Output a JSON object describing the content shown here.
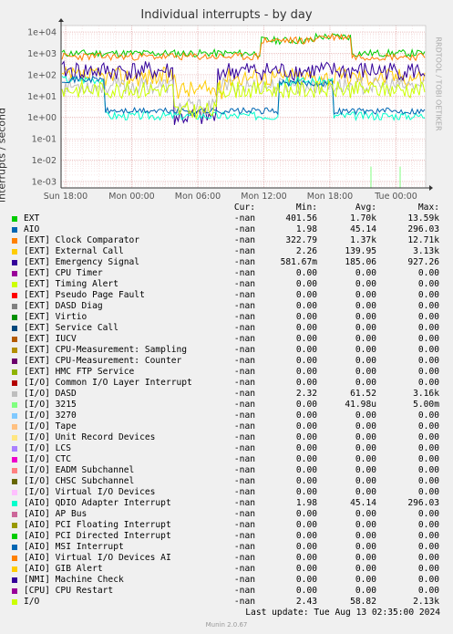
{
  "chart_data": {
    "type": "line",
    "title": "Individual interrupts - by day",
    "ylabel": "interrupts / second",
    "yscale": "log",
    "ylim": [
      0.0005,
      20000
    ],
    "y_ticks": [
      "1e-03",
      "1e-02",
      "1e-01",
      "1e+00",
      "1e+01",
      "1e+02",
      "1e+03",
      "1e+04"
    ],
    "x_ticks": [
      "Sun 18:00",
      "Mon 00:00",
      "Mon 06:00",
      "Mon 12:00",
      "Mon 18:00",
      "Tue 00:00"
    ],
    "series": [
      {
        "name": "EXT",
        "color": "#00cc00",
        "cur": "-nan",
        "min": "401.56",
        "avg": "1.70k",
        "max": "13.59k"
      },
      {
        "name": "AIO",
        "color": "#0066b3",
        "cur": "-nan",
        "min": "1.98",
        "avg": "45.14",
        "max": "296.03"
      },
      {
        "name": "[EXT] Clock Comparator",
        "color": "#ff8000",
        "cur": "-nan",
        "min": "322.79",
        "avg": "1.37k",
        "max": "12.71k"
      },
      {
        "name": "[EXT] External Call",
        "color": "#ffcc00",
        "cur": "-nan",
        "min": "2.26",
        "avg": "139.95",
        "max": "3.13k"
      },
      {
        "name": "[EXT] Emergency Signal",
        "color": "#330099",
        "cur": "-nan",
        "min": "581.67m",
        "avg": "185.06",
        "max": "927.26"
      },
      {
        "name": "[EXT] CPU Timer",
        "color": "#990099",
        "cur": "-nan",
        "min": "0.00",
        "avg": "0.00",
        "max": "0.00"
      },
      {
        "name": "[EXT] Timing Alert",
        "color": "#ccff00",
        "cur": "-nan",
        "min": "0.00",
        "avg": "0.00",
        "max": "0.00"
      },
      {
        "name": "[EXT] Pseudo Page Fault",
        "color": "#ff0000",
        "cur": "-nan",
        "min": "0.00",
        "avg": "0.00",
        "max": "0.00"
      },
      {
        "name": "[EXT] DASD Diag",
        "color": "#808080",
        "cur": "-nan",
        "min": "0.00",
        "avg": "0.00",
        "max": "0.00"
      },
      {
        "name": "[EXT] Virtio",
        "color": "#008f00",
        "cur": "-nan",
        "min": "0.00",
        "avg": "0.00",
        "max": "0.00"
      },
      {
        "name": "[EXT] Service Call",
        "color": "#00487d",
        "cur": "-nan",
        "min": "0.00",
        "avg": "0.00",
        "max": "0.00"
      },
      {
        "name": "[EXT] IUCV",
        "color": "#b35a00",
        "cur": "-nan",
        "min": "0.00",
        "avg": "0.00",
        "max": "0.00"
      },
      {
        "name": "[EXT] CPU-Measurement: Sampling",
        "color": "#b38f00",
        "cur": "-nan",
        "min": "0.00",
        "avg": "0.00",
        "max": "0.00"
      },
      {
        "name": "[EXT] CPU-Measurement: Counter",
        "color": "#6b006b",
        "cur": "-nan",
        "min": "0.00",
        "avg": "0.00",
        "max": "0.00"
      },
      {
        "name": "[EXT] HMC FTP Service",
        "color": "#8fb300",
        "cur": "-nan",
        "min": "0.00",
        "avg": "0.00",
        "max": "0.00"
      },
      {
        "name": "[I/O] Common I/O Layer Interrupt",
        "color": "#b30000",
        "cur": "-nan",
        "min": "0.00",
        "avg": "0.00",
        "max": "0.00"
      },
      {
        "name": "[I/O] DASD",
        "color": "#bebebe",
        "cur": "-nan",
        "min": "2.32",
        "avg": "61.52",
        "max": "3.16k"
      },
      {
        "name": "[I/O] 3215",
        "color": "#80ff80",
        "cur": "-nan",
        "min": "0.00",
        "avg": "41.98u",
        "max": "5.00m"
      },
      {
        "name": "[I/O] 3270",
        "color": "#80c9ff",
        "cur": "-nan",
        "min": "0.00",
        "avg": "0.00",
        "max": "0.00"
      },
      {
        "name": "[I/O] Tape",
        "color": "#ffc080",
        "cur": "-nan",
        "min": "0.00",
        "avg": "0.00",
        "max": "0.00"
      },
      {
        "name": "[I/O] Unit Record Devices",
        "color": "#ffe680",
        "cur": "-nan",
        "min": "0.00",
        "avg": "0.00",
        "max": "0.00"
      },
      {
        "name": "[I/O] LCS",
        "color": "#aa80ff",
        "cur": "-nan",
        "min": "0.00",
        "avg": "0.00",
        "max": "0.00"
      },
      {
        "name": "[I/O] CTC",
        "color": "#ee00cc",
        "cur": "-nan",
        "min": "0.00",
        "avg": "0.00",
        "max": "0.00"
      },
      {
        "name": "[I/O] EADM Subchannel",
        "color": "#ff8080",
        "cur": "-nan",
        "min": "0.00",
        "avg": "0.00",
        "max": "0.00"
      },
      {
        "name": "[I/O] CHSC Subchannel",
        "color": "#666600",
        "cur": "-nan",
        "min": "0.00",
        "avg": "0.00",
        "max": "0.00"
      },
      {
        "name": "[I/O] Virtual I/O Devices",
        "color": "#ffbfff",
        "cur": "-nan",
        "min": "0.00",
        "avg": "0.00",
        "max": "0.00"
      },
      {
        "name": "[AIO] QDIO Adapter Interrupt",
        "color": "#00ffcc",
        "cur": "-nan",
        "min": "1.98",
        "avg": "45.14",
        "max": "296.03"
      },
      {
        "name": "[AIO] AP Bus",
        "color": "#cc6699",
        "cur": "-nan",
        "min": "0.00",
        "avg": "0.00",
        "max": "0.00"
      },
      {
        "name": "[AIO] PCI Floating Interrupt",
        "color": "#999900",
        "cur": "-nan",
        "min": "0.00",
        "avg": "0.00",
        "max": "0.00"
      },
      {
        "name": "[AIO] PCI Directed Interrupt",
        "color": "#00cc00",
        "cur": "-nan",
        "min": "0.00",
        "avg": "0.00",
        "max": "0.00"
      },
      {
        "name": "[AIO] MSI Interrupt",
        "color": "#0066b3",
        "cur": "-nan",
        "min": "0.00",
        "avg": "0.00",
        "max": "0.00"
      },
      {
        "name": "[AIO] Virtual I/O Devices AI",
        "color": "#ff8000",
        "cur": "-nan",
        "min": "0.00",
        "avg": "0.00",
        "max": "0.00"
      },
      {
        "name": "[AIO] GIB Alert",
        "color": "#ffcc00",
        "cur": "-nan",
        "min": "0.00",
        "avg": "0.00",
        "max": "0.00"
      },
      {
        "name": "[NMI] Machine Check",
        "color": "#330099",
        "cur": "-nan",
        "min": "0.00",
        "avg": "0.00",
        "max": "0.00"
      },
      {
        "name": "[CPU] CPU Restart",
        "color": "#990099",
        "cur": "-nan",
        "min": "0.00",
        "avg": "0.00",
        "max": "0.00"
      },
      {
        "name": "I/O",
        "color": "#ccff00",
        "cur": "-nan",
        "min": "2.43",
        "avg": "58.82",
        "max": "2.13k"
      }
    ]
  },
  "legend_headers": {
    "cur": "Cur:",
    "min": "Min:",
    "avg": "Avg:",
    "max": "Max:"
  },
  "last_update": "Last update: Tue Aug 13 02:35:00 2024",
  "watermark": "RRDTOOL / TOBI OETIKER",
  "footer": "Munin 2.0.67"
}
